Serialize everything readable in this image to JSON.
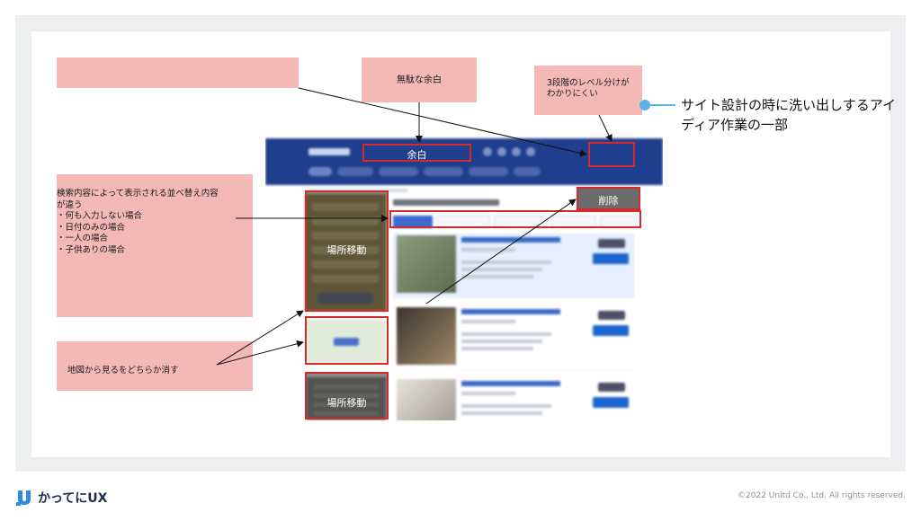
{
  "annotations": {
    "wasted_space": "無駄な余白",
    "level_split": "3段階のレベル分けが\nわかりにくい",
    "sort_note": "検索内容によって表示される並べ替え内容\nが違う\n・何も入力しない場合\n・日付のみの場合\n・一人の場合\n・子供ありの場合",
    "map_note": "地図から見るをどちらか消す"
  },
  "labels": {
    "margin": "余白",
    "delete": "削除",
    "move_top": "場所移動",
    "move_bottom": "場所移動"
  },
  "side_note": "サイト設計の時に洗い出しするアイディア作業の一部",
  "footer": {
    "brand": "かってにUX",
    "copyright": "©2022 Unitd Co., Ltd. All rights reserved."
  },
  "colors": {
    "annotation_box": "#f4b8b7",
    "highlight_border": "#d42a2a",
    "accent_dot": "#5ab4e8",
    "booking_blue": "#1f3f8e"
  }
}
